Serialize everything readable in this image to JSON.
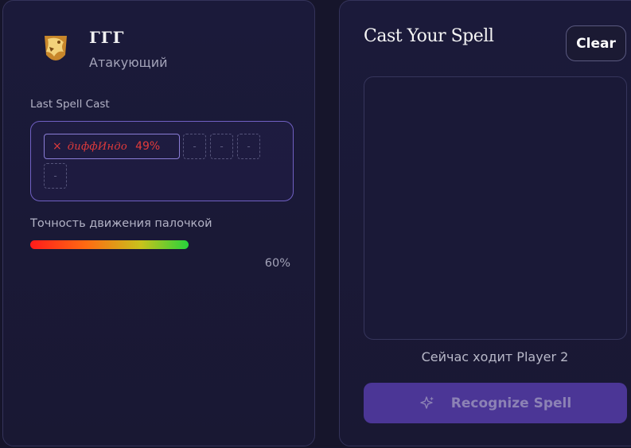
{
  "player": {
    "name": "ГГГ",
    "role": "Атакующий"
  },
  "last_spell": {
    "label": "Last Spell Cast",
    "chip": {
      "symbol": "×",
      "name": "диффИндо",
      "percent": "49%",
      "color": "#e23b3b"
    },
    "empty_slots": [
      "-",
      "-",
      "-",
      "-"
    ]
  },
  "accuracy": {
    "label": "Точность движения палочкой",
    "value_text": "60%",
    "value": 0.6
  },
  "cast_panel": {
    "title": "Cast Your Spell",
    "clear_label": "Clear",
    "turn_status": "Сейчас ходит Player 2",
    "recognize_label": "Recognize Spell",
    "recognize_icon": "sparkles-icon"
  },
  "colors": {
    "background": "#16152b",
    "panel_border": "#34335a",
    "accent": "#7060c2",
    "button": "#4b3696",
    "error": "#e23b3b"
  }
}
